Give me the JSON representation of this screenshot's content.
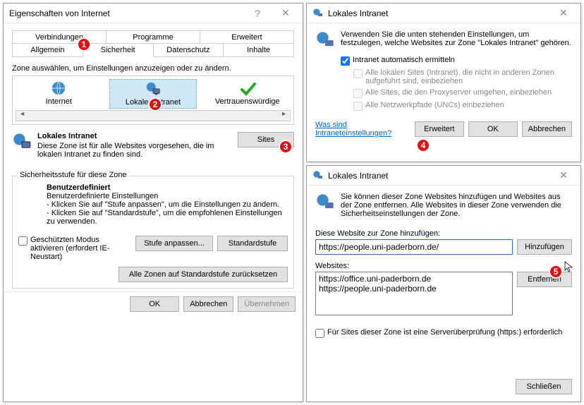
{
  "win1": {
    "title": "Eigenschaften von Internet",
    "tabs_top": [
      "Verbindungen",
      "Programme",
      "Erweitert"
    ],
    "tabs_bottom": [
      "Allgemein",
      "Sicherheit",
      "Datenschutz",
      "Inhalte"
    ],
    "zone_prompt": "Zone auswählen, um Einstellungen anzuzeigen oder zu ändern.",
    "zones": [
      "Internet",
      "Lokales Intranet",
      "Vertrauenswürdige"
    ],
    "zone_heading": "Lokales Intranet",
    "zone_desc": "Diese Zone ist für alle Websites vorgesehen, die im lokalen Intranet zu finden sind.",
    "sites_btn": "Sites",
    "sec_group": "Sicherheitsstufe für diese Zone",
    "level_title": "Benutzerdefiniert",
    "level_line1": "Benutzerdefinierte Einstellungen",
    "level_line2": "- Klicken Sie auf \"Stufe anpassen\", um die Einstellungen zu ändern.",
    "level_line3": "- Klicken Sie auf \"Standardstufe\", um die empfohlenen Einstellungen zu verwenden.",
    "protected_label": "Geschützten Modus aktivieren (erfordert IE-Neustart)",
    "btn_custom": "Stufe anpassen...",
    "btn_default": "Standardstufe",
    "btn_resetall": "Alle Zonen auf Standardstufe zurücksetzen",
    "ok": "OK",
    "cancel": "Abbrechen",
    "apply": "Übernehmen"
  },
  "win2": {
    "title": "Lokales Intranet",
    "intro": "Verwenden Sie die unten stehenden Einstellungen, um festzulegen, welche Websites zur Zone \"Lokales Intranet\" gehören.",
    "cb1": "Intranet automatisch ermitteln",
    "cb2": "Alle lokalen Sites (Intranet), die nicht in anderen Zonen aufgeführt sind, einbeziehen",
    "cb3": "Alle Sites, die den Proxyserver umgehen, einbeziehen",
    "cb4": "Alle Netzwerkpfade (UNCs) einbeziehen",
    "link": "Was sind Intraneteinstellungen?",
    "adv": "Erweitert",
    "ok": "OK",
    "cancel": "Abbrechen"
  },
  "win3": {
    "title": "Lokales Intranet",
    "intro": "Sie können dieser Zone Websites hinzufügen und Websites aus der Zone entfernen. Alle Websites in dieser Zone verwenden die Sicherheitseinstellungen der Zone.",
    "add_label": "Diese Website zur Zone hinzufügen:",
    "add_value": "https://people.uni-paderborn.de/",
    "add_btn": "Hinzufügen",
    "list_label": "Websites:",
    "list_items": [
      "https://office.uni-paderborn.de",
      "https://people.uni-paderborn.de"
    ],
    "remove_btn": "Entfernen",
    "verify_cb": "Für Sites dieser Zone ist eine Serverüberprüfung (https:) erforderlich",
    "close": "Schließen"
  },
  "markers": [
    "1",
    "2",
    "3",
    "4",
    "5"
  ]
}
